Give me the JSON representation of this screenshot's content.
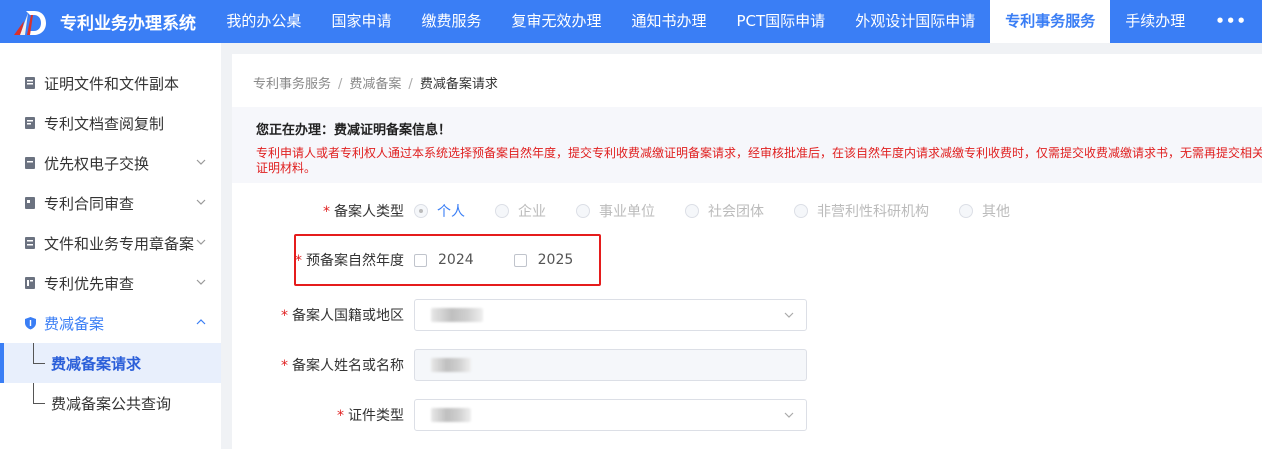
{
  "brand": {
    "title": "专利业务办理系统"
  },
  "nav": {
    "items": [
      "我的办公桌",
      "国家申请",
      "缴费服务",
      "复审无效办理",
      "通知书办理",
      "PCT国际申请",
      "外观设计国际申请",
      "专利事务服务",
      "手续办理"
    ],
    "active_index": 7,
    "more": "•••"
  },
  "sidebar": {
    "items": [
      {
        "label": "证明文件和文件副本",
        "icon": "document-icon",
        "chevron": false
      },
      {
        "label": "专利文档查阅复制",
        "icon": "copy-document-icon",
        "chevron": false
      },
      {
        "label": "优先权电子交换",
        "icon": "exchange-document-icon",
        "chevron": true
      },
      {
        "label": "专利合同审查",
        "icon": "contract-icon",
        "chevron": true
      },
      {
        "label": "文件和业务专用章备案",
        "icon": "stamp-document-icon",
        "chevron": true
      },
      {
        "label": "专利优先审查",
        "icon": "priority-document-icon",
        "chevron": true
      },
      {
        "label": "费减备案",
        "icon": "shield-icon",
        "chevron": true,
        "open": true
      }
    ],
    "subitems": [
      {
        "label": "费减备案请求",
        "active": true
      },
      {
        "label": "费减备案公共查询",
        "active": false
      }
    ]
  },
  "breadcrumb": {
    "items": [
      "专利事务服务",
      "费减备案",
      "费减备案请求"
    ],
    "separator": "/"
  },
  "notice": {
    "title": "您正在办理：费减证明备案信息！",
    "text": "专利申请人或者专利权人通过本系统选择预备案自然年度，提交专利收费减缴证明备案请求，经审核批准后，在该自然年度内请求减缴专利收费时，仅需提交收费减缴请求书，无需再提交相关证明材料。"
  },
  "form": {
    "type_label": "备案人类型",
    "type_options": [
      "个人",
      "企业",
      "事业单位",
      "社会团体",
      "非营利性科研机构",
      "其他"
    ],
    "type_selected": 0,
    "year_label": "预备案自然年度",
    "year_options": [
      "2024",
      "2025"
    ],
    "nationality_label": "备案人国籍或地区",
    "name_label": "备案人姓名或名称",
    "id_type_label": "证件类型",
    "required_mark": "*"
  },
  "colors": {
    "primary": "#3a7ef5",
    "required": "#e02020",
    "highlight": "#e51c1c"
  }
}
